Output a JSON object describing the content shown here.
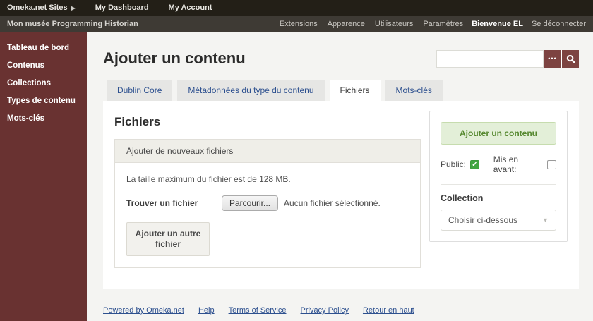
{
  "topbar": {
    "items": [
      {
        "label": "Omeka.net Sites",
        "has_caret": true
      },
      {
        "label": "My Dashboard",
        "has_caret": false
      },
      {
        "label": "My Account",
        "has_caret": false
      }
    ],
    "caret_glyph": "▶"
  },
  "adminbar": {
    "site_title": "Mon musée Programming Historian",
    "links": [
      "Extensions",
      "Apparence",
      "Utilisateurs",
      "Paramètres"
    ],
    "welcome": "Bienvenue EL",
    "logout": "Se déconnecter"
  },
  "sidebar": {
    "items": [
      "Tableau de bord",
      "Contenus",
      "Collections",
      "Types de contenu",
      "Mots-clés"
    ]
  },
  "header": {
    "title": "Ajouter un contenu",
    "search": {
      "value": "",
      "advanced_glyph": "•••"
    }
  },
  "tabs": {
    "labels": [
      "Dublin Core",
      "Métadonnées du type du contenu",
      "Fichiers",
      "Mots-clés"
    ],
    "active_index": 2
  },
  "files_section": {
    "heading": "Fichiers",
    "box_title": "Ajouter de nouveaux fichiers",
    "max_size_note": "La taille maximum du fichier est de 128 MB.",
    "find_file_label": "Trouver un fichier",
    "browse_button": "Parcourir...",
    "no_file_text": "Aucun fichier sélectionné.",
    "add_another_button": "Ajouter un autre fichier"
  },
  "save_panel": {
    "submit_button": "Ajouter un contenu",
    "public_label": "Public:",
    "public_checked": true,
    "featured_label": "Mis en avant:",
    "featured_checked": false,
    "check_glyph": "✓",
    "collection_label": "Collection",
    "collection_value": "Choisir ci-dessous",
    "dropdown_glyph": "▼"
  },
  "footer": {
    "links": [
      "Powered by Omeka.net",
      "Help",
      "Terms of Service",
      "Privacy Policy",
      "Retour en haut"
    ]
  },
  "colors": {
    "sidebar_maroon": "#693231",
    "button_maroon": "#7d4341",
    "link_blue": "#2d508f",
    "submit_green_bg": "#e3efd8",
    "submit_green_text": "#56882f",
    "checkbox_green": "#42a542",
    "topbar_dark": "#231f17",
    "adminbar_gray": "#3e3a34"
  }
}
